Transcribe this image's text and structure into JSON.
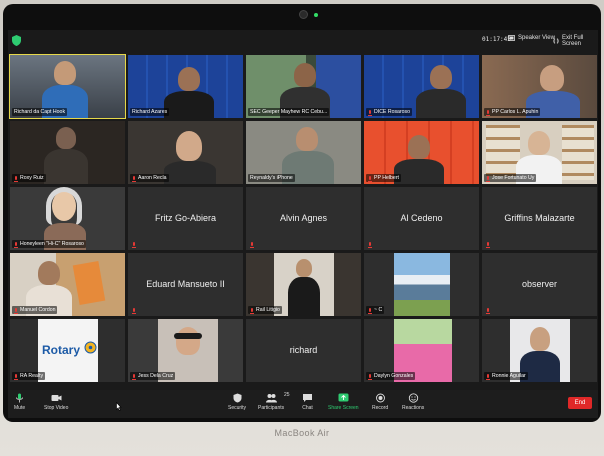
{
  "device": {
    "brand_label": "MacBook Air"
  },
  "topbar": {
    "timer": "01:17:45",
    "speaker_view_label": "Speaker View",
    "exit_fullscreen_label": "Exit Full Screen"
  },
  "participants": [
    {
      "name": "Richard da Capt Hook",
      "muted": false
    },
    {
      "name": "Richard Azares",
      "muted": false
    },
    {
      "name": "SEC Geeper Mayhew RC Cebu...",
      "muted": false
    },
    {
      "name": "DICE Rosaroso",
      "muted": true
    },
    {
      "name": "PP Carlos L. Apuhin",
      "muted": true
    },
    {
      "name": "Roxy Ruiz",
      "muted": true
    },
    {
      "name": "Aaron Recla",
      "muted": true
    },
    {
      "name": "Reynaldy's iPhone",
      "muted": false
    },
    {
      "name": "PP Helbert",
      "muted": true
    },
    {
      "name": "Jose Fortunato Uy",
      "muted": true
    },
    {
      "name": "Honeyleen \"Hi-C\" Rosaroso",
      "muted": true
    },
    {
      "name": "Fritz Go-Abiera",
      "muted": true
    },
    {
      "name": "Alvin Agnes",
      "muted": true
    },
    {
      "name": "Al Cedeno",
      "muted": true
    },
    {
      "name": "Griffins Malazarte",
      "muted": true
    },
    {
      "name": "Manuel Cordon",
      "muted": true
    },
    {
      "name": "Eduard Mansueto II",
      "muted": true
    },
    {
      "name": "Rail Litigio",
      "muted": true
    },
    {
      "name": "~ C",
      "muted": true
    },
    {
      "name": "observer",
      "muted": true
    },
    {
      "name": "RA Realty",
      "muted": true
    },
    {
      "name": "Jess Dela Cruz",
      "muted": true
    },
    {
      "name": "richard",
      "muted": true
    },
    {
      "name": "Daylyn Gonzales",
      "muted": true
    },
    {
      "name": "Ronnie Aguilar",
      "muted": true
    }
  ],
  "rotary_tile_text": "Rotary",
  "toolbar": {
    "mute_label": "Mute",
    "stop_video_label": "Stop Video",
    "security_label": "Security",
    "participants_label": "Participants",
    "participants_count": "25",
    "chat_label": "Chat",
    "share_screen_label": "Share Screen",
    "record_label": "Record",
    "reactions_label": "Reactions",
    "end_label": "End"
  },
  "colors": {
    "active_speaker_border": "#e6d84a",
    "share_screen_green": "#2ecc71",
    "end_red": "#e02828",
    "mute_red": "#e53935"
  }
}
